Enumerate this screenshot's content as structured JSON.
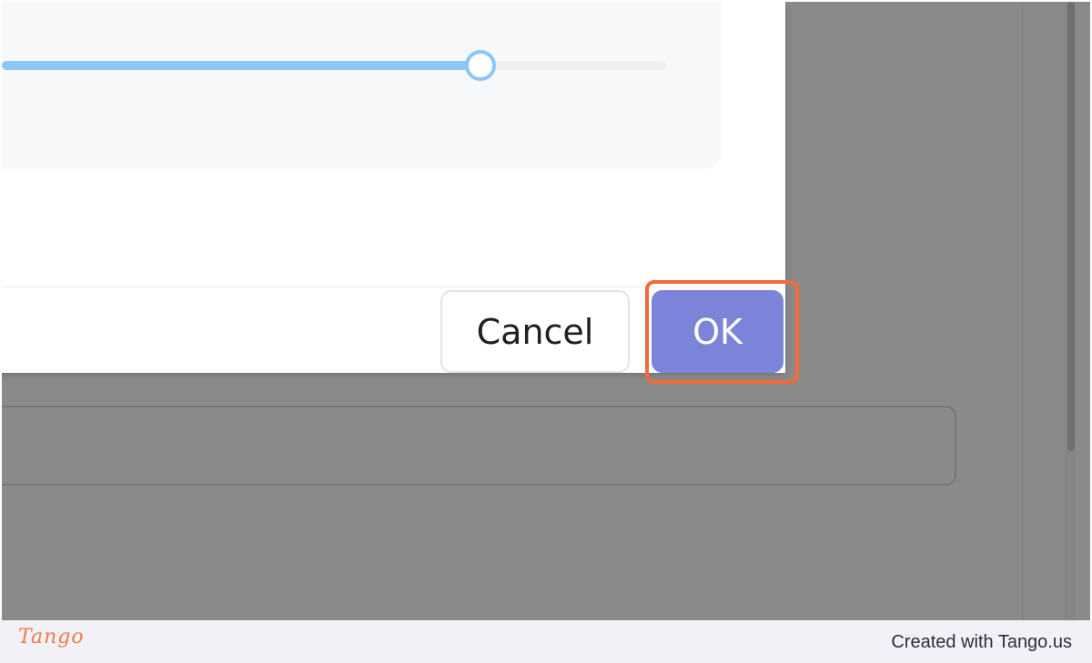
{
  "dialog": {
    "slider": {
      "value_fraction": 0.72
    },
    "buttons": {
      "cancel_label": "Cancel",
      "ok_label": "OK"
    }
  },
  "highlight": {
    "target": "ok-button",
    "color": "#f26b3a"
  },
  "colors": {
    "overlay": "#8a8a8a",
    "ok_button": "#7b84d8",
    "slider_fill": "#8cc6f8"
  },
  "footer": {
    "logo_text": "Tango",
    "credit_text": "Created with Tango.us"
  }
}
